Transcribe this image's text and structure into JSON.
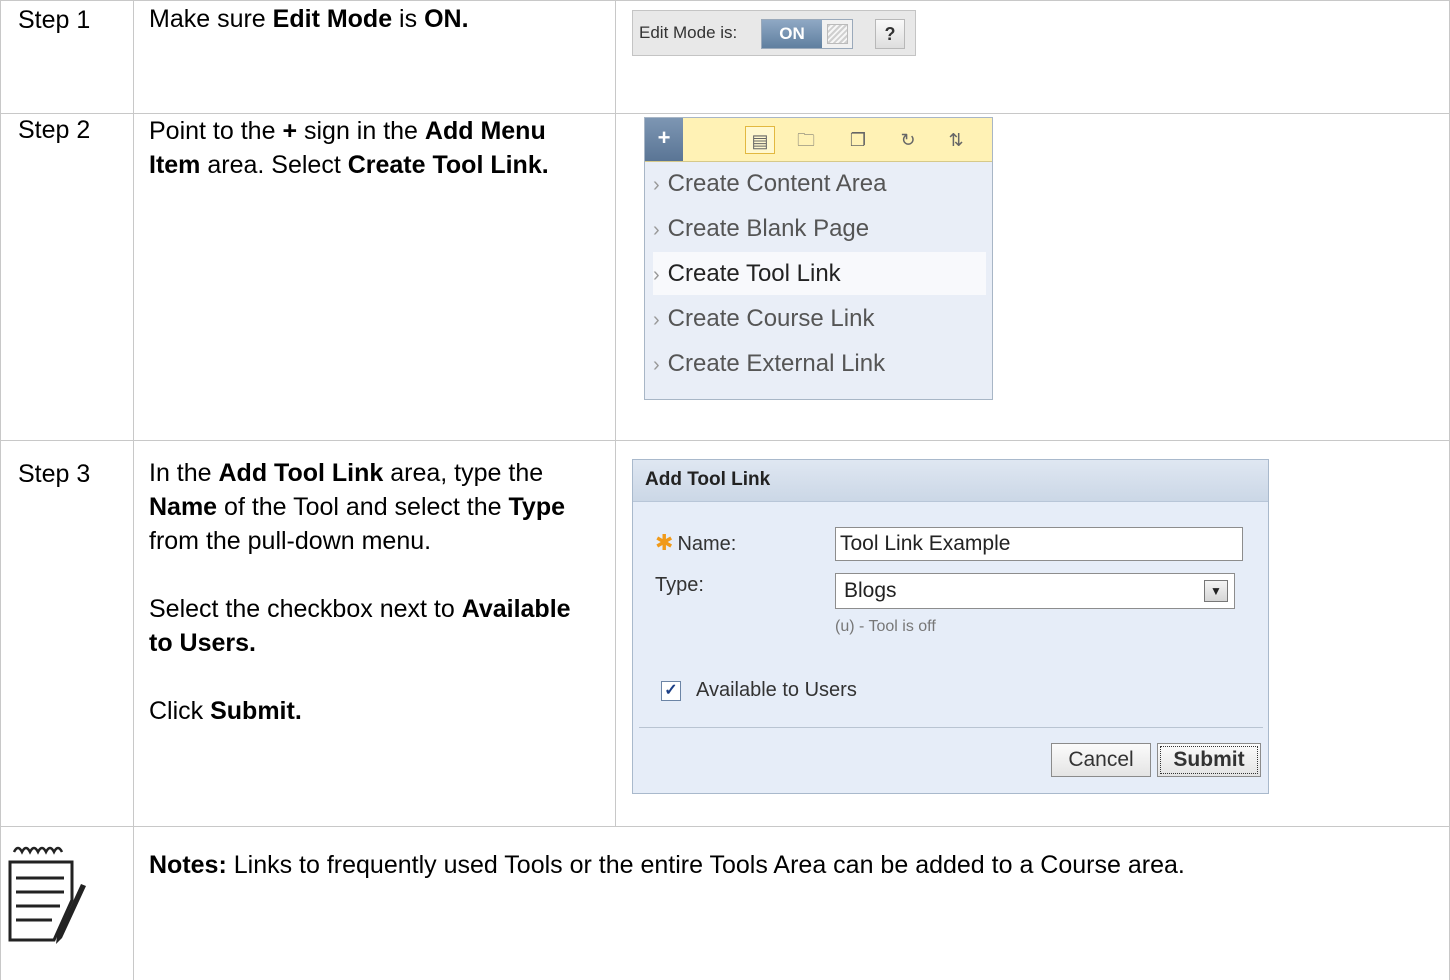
{
  "steps": [
    {
      "label": "Step 1",
      "text_html": "Make sure <b>Edit Mode</b> is <b>ON.</b>"
    },
    {
      "label": "Step 2",
      "text_html": "Point to the <b>+</b> sign in the <b>Add Menu Item</b> area. Select <b>Create Tool Link.</b>"
    },
    {
      "label": "Step 3",
      "text_html": "In the <b>Add Tool Link</b> area, type the <b>Name</b> of the Tool and select the <b>Type</b> from the pull-down menu.<br><br>Select the checkbox next to <b>Available to Users.</b><br><br>Click <b>Submit.</b>"
    }
  ],
  "edit_mode": {
    "label": "Edit Mode is:",
    "state": "ON",
    "help": "?"
  },
  "add_menu": {
    "plus": "+",
    "icons": [
      "list-icon",
      "folder-icon",
      "window-icon",
      "refresh-icon",
      "sort-icon"
    ],
    "items": [
      {
        "label": "Create Content Area",
        "active": false
      },
      {
        "label": "Create Blank Page",
        "active": false
      },
      {
        "label": "Create Tool Link",
        "active": true
      },
      {
        "label": "Create Course Link",
        "active": false
      },
      {
        "label": "Create External Link",
        "active": false
      }
    ]
  },
  "add_tool_link": {
    "title": "Add Tool Link",
    "name_label": "Name:",
    "name_value": "Tool Link Example",
    "type_label": "Type:",
    "type_value": "Blogs",
    "type_hint": "(u) - Tool is off",
    "available_label": "Available to Users",
    "available_checked": true,
    "cancel_label": "Cancel",
    "submit_label": "Submit"
  },
  "notes": {
    "label": "Notes:",
    "text": " Links to frequently used Tools or the entire Tools Area can be added to a Course area."
  }
}
